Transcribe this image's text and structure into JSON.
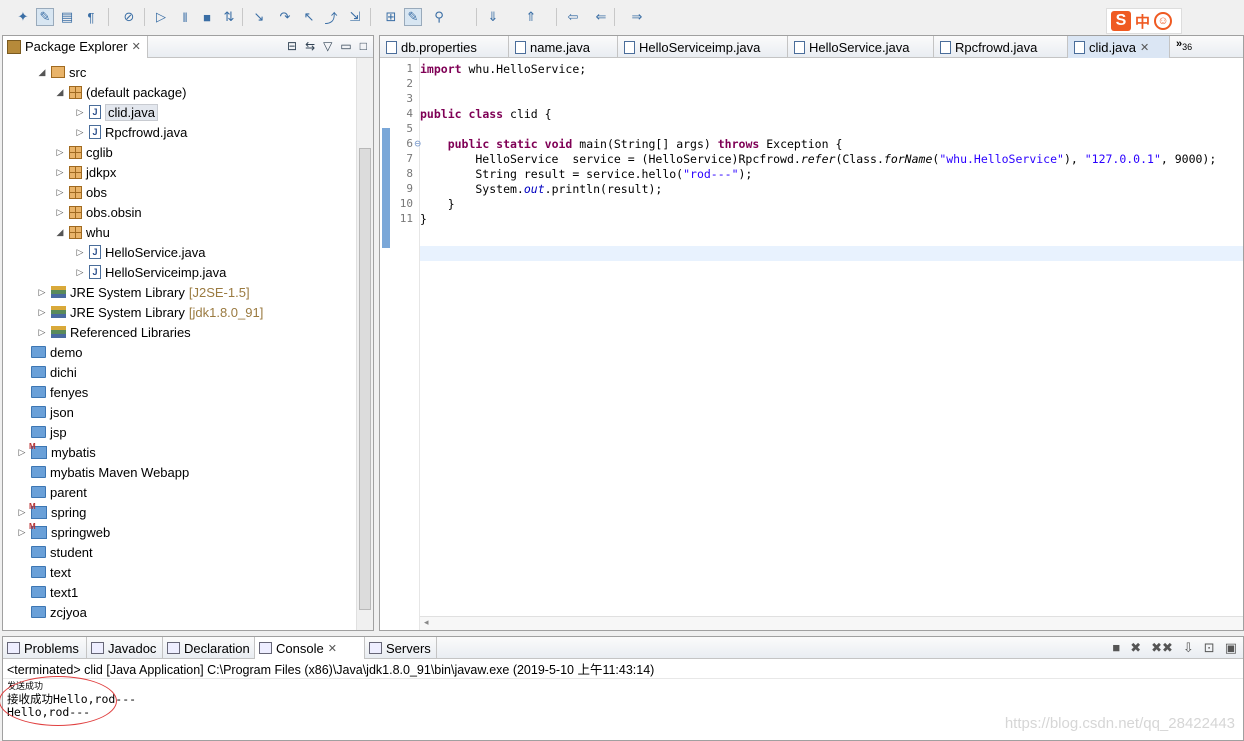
{
  "toolbar": {
    "icons": [
      "debug-icon",
      "pen-icon",
      "layout-icon",
      "paragraph-icon",
      "skip-breakpoints-icon",
      "resume-icon",
      "suspend-icon",
      "terminate-icon",
      "disconnect-icon",
      "step-into-icon",
      "step-over-icon",
      "step-return-icon",
      "drop-to-frame-icon",
      "use-step-filters-icon",
      "open-type-icon",
      "toggle-mark-icon",
      "pin-icon",
      "next-annotation-icon",
      "prev-annotation-icon",
      "last-edit-icon",
      "back-icon",
      "forward-icon"
    ]
  },
  "ime": {
    "s": "S",
    "lang": "中",
    "face": "☺"
  },
  "package_explorer": {
    "title": "Package Explorer",
    "tree": [
      {
        "label": "src",
        "indent": 2,
        "arrow": "down",
        "icon": "src"
      },
      {
        "label": "(default package)",
        "indent": 3,
        "arrow": "down",
        "icon": "pkg"
      },
      {
        "label": "clid.java",
        "indent": 4,
        "arrow": "right",
        "icon": "jfile",
        "selected": true
      },
      {
        "label": "Rpcfrowd.java",
        "indent": 4,
        "arrow": "right",
        "icon": "jfile"
      },
      {
        "label": "cglib",
        "indent": 3,
        "arrow": "right",
        "icon": "pkg"
      },
      {
        "label": "jdkpx",
        "indent": 3,
        "arrow": "right",
        "icon": "pkg"
      },
      {
        "label": "obs",
        "indent": 3,
        "arrow": "right",
        "icon": "pkg"
      },
      {
        "label": "obs.obsin",
        "indent": 3,
        "arrow": "right",
        "icon": "pkg"
      },
      {
        "label": "whu",
        "indent": 3,
        "arrow": "down",
        "icon": "pkg"
      },
      {
        "label": "HelloService.java",
        "indent": 4,
        "arrow": "right",
        "icon": "jfile"
      },
      {
        "label": "HelloServiceimp.java",
        "indent": 4,
        "arrow": "right",
        "icon": "jfile"
      },
      {
        "label": "JRE System Library",
        "version": "[J2SE-1.5]",
        "indent": 2,
        "arrow": "right",
        "icon": "lib"
      },
      {
        "label": "JRE System Library",
        "version": "[jdk1.8.0_91]",
        "indent": 2,
        "arrow": "right",
        "icon": "lib"
      },
      {
        "label": "Referenced Libraries",
        "indent": 2,
        "arrow": "right",
        "icon": "lib"
      },
      {
        "label": "demo",
        "indent": 1,
        "arrow": "",
        "icon": "folder"
      },
      {
        "label": "dichi",
        "indent": 1,
        "arrow": "",
        "icon": "folder"
      },
      {
        "label": "fenyes",
        "indent": 1,
        "arrow": "",
        "icon": "folder"
      },
      {
        "label": "json",
        "indent": 1,
        "arrow": "",
        "icon": "folder"
      },
      {
        "label": "jsp",
        "indent": 1,
        "arrow": "",
        "icon": "folder"
      },
      {
        "label": "mybatis",
        "indent": 1,
        "arrow": "right",
        "icon": "proj"
      },
      {
        "label": "mybatis Maven Webapp",
        "indent": 1,
        "arrow": "",
        "icon": "folder"
      },
      {
        "label": "parent",
        "indent": 1,
        "arrow": "",
        "icon": "folder"
      },
      {
        "label": "spring",
        "indent": 1,
        "arrow": "right",
        "icon": "proj"
      },
      {
        "label": "springweb",
        "indent": 1,
        "arrow": "right",
        "icon": "proj"
      },
      {
        "label": "student",
        "indent": 1,
        "arrow": "",
        "icon": "folder"
      },
      {
        "label": "text",
        "indent": 1,
        "arrow": "",
        "icon": "folder"
      },
      {
        "label": "text1",
        "indent": 1,
        "arrow": "",
        "icon": "folder"
      },
      {
        "label": "zcjyoa",
        "indent": 1,
        "arrow": "",
        "icon": "folder"
      }
    ]
  },
  "editor": {
    "tabs": [
      "db.properties",
      "name.java",
      "HelloServiceimp.java",
      "HelloService.java",
      "Rpcfrowd.java",
      "clid.java"
    ],
    "active_tab": "clid.java",
    "more_count": "36",
    "more_symbol": "»",
    "line_numbers": [
      "1",
      "2",
      "3",
      "4",
      "5",
      "6",
      "7",
      "8",
      "9",
      "10",
      "11"
    ],
    "fold_marker": "⊖",
    "code_lines": [
      [
        {
          "t": "import ",
          "c": "kw"
        },
        {
          "t": "whu.HelloService;",
          "c": ""
        }
      ],
      [],
      [],
      [
        {
          "t": "public ",
          "c": "kw"
        },
        {
          "t": "class ",
          "c": "kw"
        },
        {
          "t": "clid {",
          "c": ""
        }
      ],
      [],
      [
        {
          "t": "    ",
          "c": ""
        },
        {
          "t": "public ",
          "c": "kw"
        },
        {
          "t": "static ",
          "c": "kw"
        },
        {
          "t": "void ",
          "c": "kw"
        },
        {
          "t": "main(String[] args) ",
          "c": ""
        },
        {
          "t": "throws ",
          "c": "kw"
        },
        {
          "t": "Exception {",
          "c": ""
        }
      ],
      [
        {
          "t": "        HelloService  service = (HelloService)Rpcfrowd.",
          "c": ""
        },
        {
          "t": "refer",
          "c": "it"
        },
        {
          "t": "(Class.",
          "c": ""
        },
        {
          "t": "forName",
          "c": "it"
        },
        {
          "t": "(",
          "c": ""
        },
        {
          "t": "\"whu.HelloService\"",
          "c": "str"
        },
        {
          "t": "), ",
          "c": ""
        },
        {
          "t": "\"127.0.0.1\"",
          "c": "str"
        },
        {
          "t": ", 9000);",
          "c": ""
        }
      ],
      [
        {
          "t": "        String result = service.hello(",
          "c": ""
        },
        {
          "t": "\"rod---\"",
          "c": "str"
        },
        {
          "t": ");",
          "c": ""
        }
      ],
      [
        {
          "t": "        System.",
          "c": ""
        },
        {
          "t": "out",
          "c": "fld"
        },
        {
          "t": ".println(result);",
          "c": ""
        }
      ],
      [
        {
          "t": "    }",
          "c": ""
        }
      ],
      [
        {
          "t": "}",
          "c": ""
        }
      ]
    ]
  },
  "console_view": {
    "tabs": [
      "Problems",
      "Javadoc",
      "Declaration",
      "Console",
      "Servers"
    ],
    "active_tab": "Console",
    "status": "<terminated> clid [Java Application] C:\\Program Files (x86)\\Java\\jdk1.8.0_91\\bin\\javaw.exe (2019-5-10 上午11:43:14)",
    "output": [
      "发送成功",
      "接收成功Hello,rod---",
      "Hello,rod---"
    ],
    "watermark": "https://blog.csdn.net/qq_28422443"
  }
}
